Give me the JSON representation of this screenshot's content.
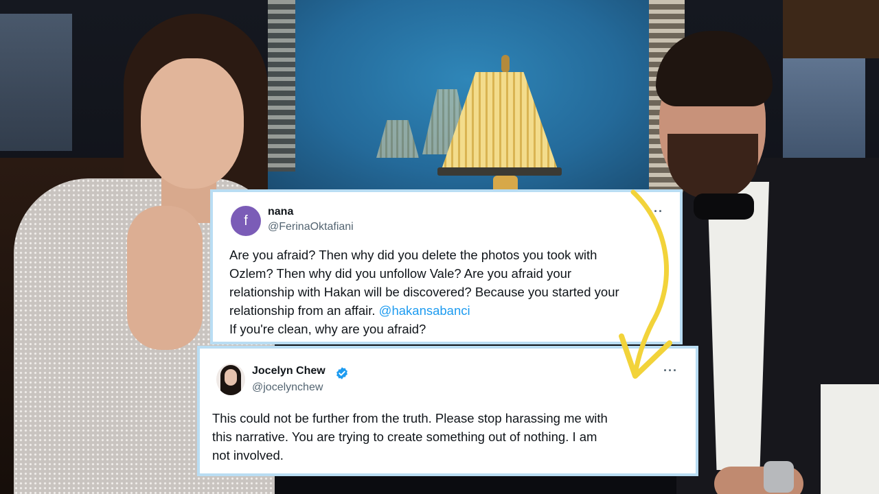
{
  "tweets": [
    {
      "avatar_letter": "f",
      "name": "nana",
      "handle": "@FerinaOktafiani",
      "more": "···",
      "lines": [
        "Are you afraid? Then why did you delete the photos you took with",
        "Ozlem? Then why did you unfollow Vale? Are you afraid your",
        "relationship with Hakan will be discovered? Because you started your",
        "relationship from an affair. "
      ],
      "mention": "@hakansabanci",
      "last_line": "If you're clean, why are you afraid?"
    },
    {
      "name": "Jocelyn Chew",
      "handle": "@jocelynchew",
      "verified": true,
      "more": "···",
      "lines": [
        "This could not be further from the truth. Please stop harassing me with",
        "this narrative. You are trying to create something out of nothing. I am",
        "not involved."
      ]
    }
  ],
  "colors": {
    "card_border": "#b9ddf3",
    "mention": "#1d9bf0",
    "verified": "#1d9bf0",
    "arrow": "#f2d33a"
  }
}
